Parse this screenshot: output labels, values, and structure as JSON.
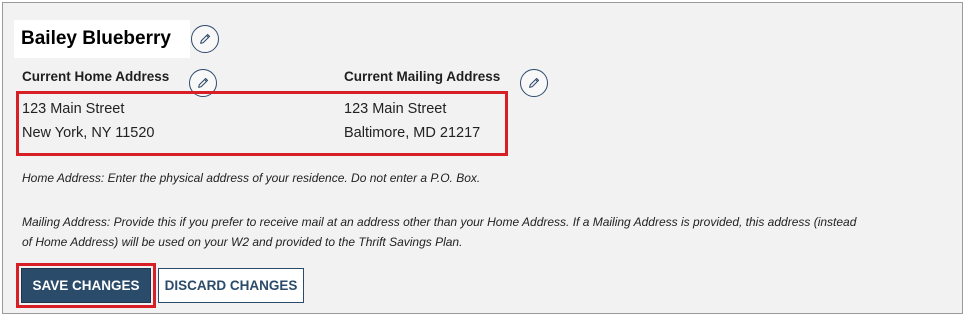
{
  "profile": {
    "name": "Bailey Blueberry"
  },
  "home_address": {
    "heading": "Current Home Address",
    "line1": "123 Main Street",
    "line2": "New York, NY 11520"
  },
  "mailing_address": {
    "heading": "Current Mailing Address",
    "line1": "123 Main Street",
    "line2": "Baltimore, MD 21217"
  },
  "notes": {
    "home": "Home Address: Enter the physical address of your residence. Do not enter a P.O. Box.",
    "mailing_line1": "Mailing Address: Provide this if you prefer to receive mail at an address other than your Home Address. If a Mailing Address is provided, this address (instead",
    "mailing_line2": "of Home Address) will be used on your W2 and provided to the Thrift Savings Plan."
  },
  "actions": {
    "save_label": "SAVE CHANGES",
    "discard_label": "DISCARD CHANGES"
  },
  "icons": {
    "edit": "pencil-icon"
  },
  "colors": {
    "primary": "#2b4b6b",
    "highlight": "#d81f26",
    "panel_background": "#f2f2f2"
  }
}
